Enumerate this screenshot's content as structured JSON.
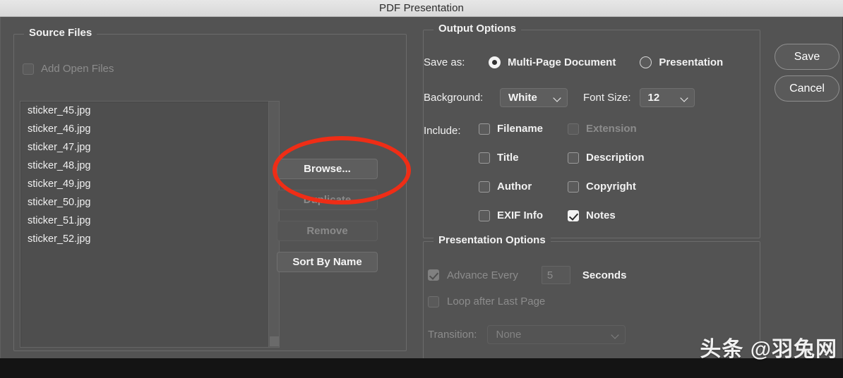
{
  "window": {
    "title": "PDF Presentation"
  },
  "source_files": {
    "legend": "Source Files",
    "add_open_files_label": "Add Open Files",
    "add_open_files_checked": false,
    "files": [
      "sticker_45.jpg",
      "sticker_46.jpg",
      "sticker_47.jpg",
      "sticker_48.jpg",
      "sticker_49.jpg",
      "sticker_50.jpg",
      "sticker_51.jpg",
      "sticker_52.jpg"
    ],
    "buttons": {
      "browse": "Browse...",
      "duplicate": "Duplicate",
      "remove": "Remove",
      "sort_by_name": "Sort By Name"
    }
  },
  "actions": {
    "save": "Save",
    "cancel": "Cancel"
  },
  "output_options": {
    "legend": "Output Options",
    "save_as_label": "Save as:",
    "save_as_options": [
      {
        "label": "Multi-Page Document",
        "selected": true
      },
      {
        "label": "Presentation",
        "selected": false
      }
    ],
    "background_label": "Background:",
    "background_value": "White",
    "font_size_label": "Font Size:",
    "font_size_value": "12",
    "include_label": "Include:",
    "include_items": [
      {
        "label": "Filename",
        "checked": false,
        "disabled": false
      },
      {
        "label": "Extension",
        "checked": false,
        "disabled": true
      },
      {
        "label": "Title",
        "checked": false,
        "disabled": false
      },
      {
        "label": "Description",
        "checked": false,
        "disabled": false
      },
      {
        "label": "Author",
        "checked": false,
        "disabled": false
      },
      {
        "label": "Copyright",
        "checked": false,
        "disabled": false
      },
      {
        "label": "EXIF Info",
        "checked": false,
        "disabled": false
      },
      {
        "label": "Notes",
        "checked": true,
        "disabled": false
      }
    ]
  },
  "presentation_options": {
    "legend": "Presentation Options",
    "advance_every_label": "Advance Every",
    "advance_every_checked": true,
    "advance_seconds_value": "5",
    "seconds_label": "Seconds",
    "loop_label": "Loop after Last Page",
    "loop_checked": false,
    "transition_label": "Transition:",
    "transition_value": "None"
  },
  "annotation": {
    "color": "#ef2d16",
    "target": "browse-button"
  },
  "watermark": {
    "text": "头条 @羽兔网"
  }
}
